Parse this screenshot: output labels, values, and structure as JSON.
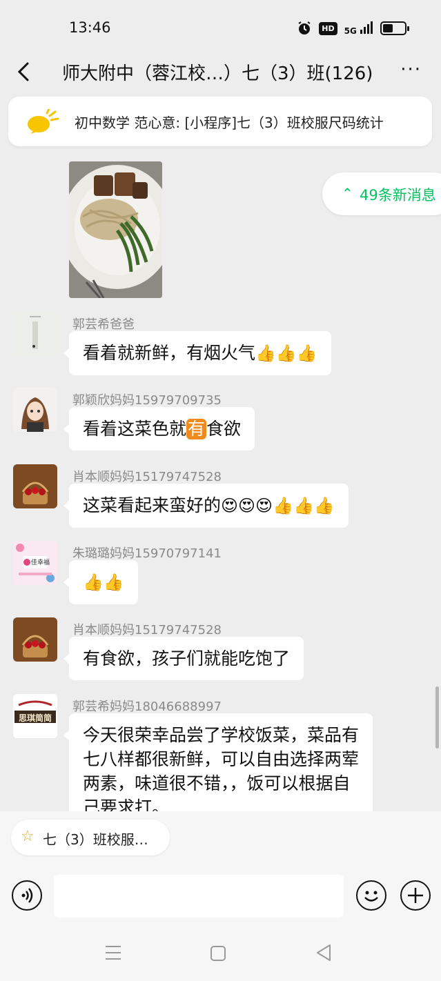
{
  "status_bar": {
    "time": "13:46",
    "hd": "HD",
    "network": "5G",
    "battery_level": 0.45
  },
  "header": {
    "title": "师大附中（蓉江校…）七（3）班(126)",
    "more": "···"
  },
  "pinned_notice": {
    "text": "初中数学 范心意: [小程序]七（3）班校服尺码统计"
  },
  "new_messages": {
    "label": "49条新消息"
  },
  "messages": [
    {
      "sender": "郭芸希爸爸",
      "text": "看着就新鲜，有烟火气",
      "emoji": "👍👍👍"
    },
    {
      "sender": "郭颖欣妈妈15979709735",
      "text_before": "看着这菜色就",
      "badge": "有",
      "text_after": "食欲"
    },
    {
      "sender": "肖本顺妈妈15179747528",
      "text": "这菜看起来蛮好的",
      "emoji": "😍😍😍👍👍👍"
    },
    {
      "sender": "朱璐璐妈妈15970797141",
      "emoji": "👍👍"
    },
    {
      "sender": "肖本顺妈妈15179747528",
      "text": "有食欲，孩子们就能吃饱了"
    },
    {
      "sender": "郭芸希妈妈18046688997",
      "text": "今天很荣幸品尝了学校饭菜，菜品有七八样都很新鲜，可以自由选择两荤两素，味道很不错，，饭可以根据自己要求打。"
    }
  ],
  "quick_chip": {
    "label": "七（3）班校服…"
  },
  "avatar_text": {
    "shop": "佳幸福",
    "brand": "思琪简简"
  },
  "colors": {
    "accent": "#07c160",
    "background": "#ededed",
    "bubble": "#ffffff",
    "notice_icon": "#f7c500"
  }
}
